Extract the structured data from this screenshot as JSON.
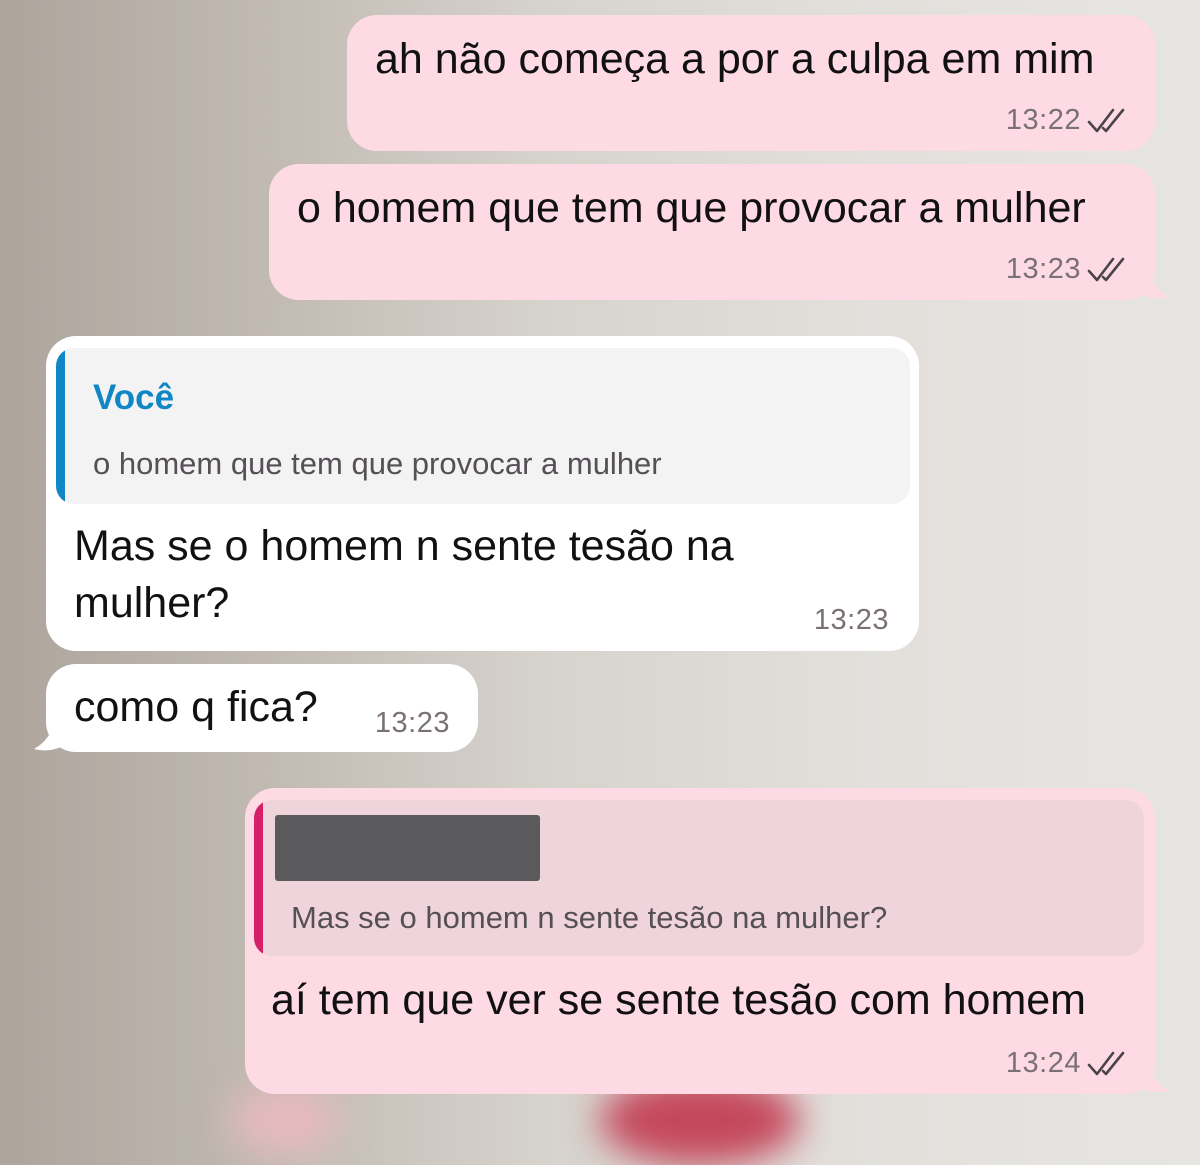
{
  "colors": {
    "outgoing_bubble": "#fedae5",
    "incoming_bubble": "#ffffff",
    "quote_incoming_bar": "#1186c4",
    "quote_outgoing_bar": "#d61f68",
    "quote_author_color": "#1186c4",
    "time_color": "#7a7176"
  },
  "messages": [
    {
      "direction": "outgoing",
      "text": "ah não começa a por a culpa em mim",
      "time": "13:22",
      "status_icon": "double-check-icon"
    },
    {
      "direction": "outgoing",
      "text": "o homem que tem que provocar a mulher",
      "time": "13:23",
      "status_icon": "double-check-icon"
    },
    {
      "direction": "incoming",
      "reply_to": {
        "author": "Você",
        "text": "o homem que tem que provocar a mulher"
      },
      "text": "Mas se o homem n sente tesão na mulher?",
      "time": "13:23"
    },
    {
      "direction": "incoming",
      "text": "como q fica?",
      "time": "13:23"
    },
    {
      "direction": "outgoing",
      "reply_to": {
        "author_redacted": true,
        "text": "Mas se o homem n sente tesão na mulher?"
      },
      "text": "aí tem que ver se sente tesão com homem",
      "time": "13:24",
      "status_icon": "double-check-icon"
    }
  ]
}
